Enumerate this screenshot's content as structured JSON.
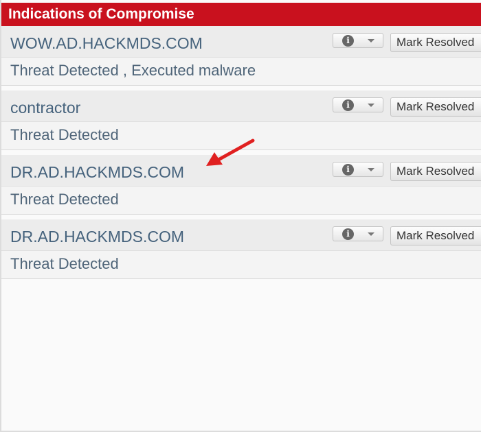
{
  "panel": {
    "title": "Indications of Compromise",
    "accent_color": "#c9111e"
  },
  "incidents": [
    {
      "host": "WOW.AD.HACKMDS.COM",
      "threat": "Threat Detected , Executed malware",
      "info_icon": "info-icon",
      "resolve_label": "Mark Resolved"
    },
    {
      "host": "contractor",
      "threat": "Threat Detected",
      "info_icon": "info-icon",
      "resolve_label": "Mark Resolved"
    },
    {
      "host": "DR.AD.HACKMDS.COM",
      "threat": "Threat Detected",
      "info_icon": "info-icon",
      "resolve_label": "Mark Resolved"
    },
    {
      "host": "DR.AD.HACKMDS.COM",
      "threat": "Threat Detected",
      "info_icon": "info-icon",
      "resolve_label": "Mark Resolved"
    }
  ],
  "annotation": {
    "arrow_color": "#e02020"
  }
}
